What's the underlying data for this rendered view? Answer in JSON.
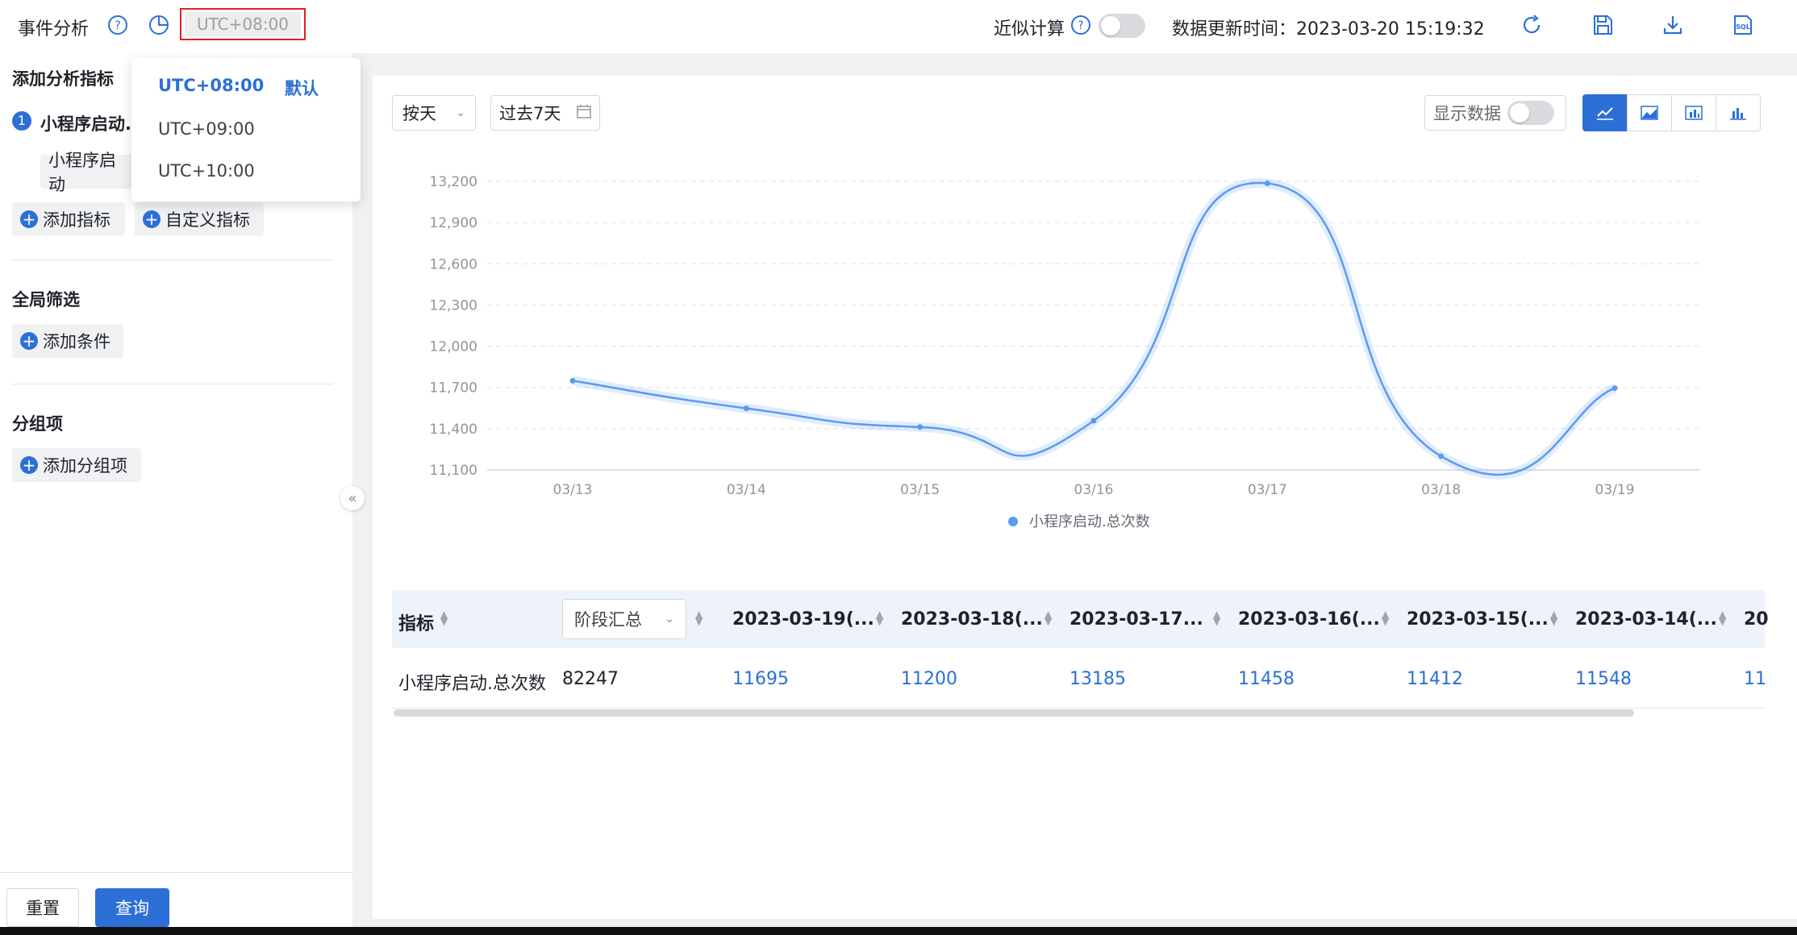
{
  "header": {
    "title": "事件分析",
    "timezone": "UTC+08:00",
    "approx_label": "近似计算",
    "update_time_label": "数据更新时间：2023-03-20 15:19:32"
  },
  "sidebar": {
    "metrics_title": "添加分析指标",
    "metric_index": "1",
    "metric_name": "小程序启动.",
    "metric_event": "小程序启动",
    "add_metric": "添加指标",
    "custom_metric": "自定义指标",
    "filter_title": "全局筛选",
    "add_condition": "添加条件",
    "group_title": "分组项",
    "add_group": "添加分组项",
    "reset": "重置",
    "query": "查询"
  },
  "timezone_dropdown": {
    "options": [
      "UTC+08:00",
      "UTC+09:00",
      "UTC+10:00"
    ],
    "default_tag": "默认"
  },
  "toolbar": {
    "granularity": "按天",
    "date_range": "过去7天",
    "show_data": "显示数据"
  },
  "chart_data": {
    "type": "line",
    "x": [
      "03/13",
      "03/14",
      "03/15",
      "03/16",
      "03/17",
      "03/18",
      "03/19"
    ],
    "y_ticks": [
      "11,100",
      "11,400",
      "11,700",
      "12,000",
      "12,300",
      "12,600",
      "12,900",
      "13,200"
    ],
    "ylim": [
      11100,
      13200
    ],
    "series": [
      {
        "name": "小程序启动.总次数",
        "values": [
          11749,
          11548,
          11412,
          11458,
          13185,
          11200,
          11695
        ],
        "color": "#5b9bf0"
      }
    ],
    "grid": true,
    "legend": "bottom-center"
  },
  "table": {
    "col_metric": "指标",
    "col_total": "阶段汇总",
    "date_cols": [
      "2023-03-19(...",
      "2023-03-18(...",
      "2023-03-17...",
      "2023-03-16(...",
      "2023-03-15(...",
      "2023-03-14(...",
      "20"
    ],
    "row": {
      "metric": "小程序启动.总次数",
      "total": "82247",
      "values": [
        "11695",
        "11200",
        "13185",
        "11458",
        "11412",
        "11548",
        "11"
      ]
    }
  }
}
